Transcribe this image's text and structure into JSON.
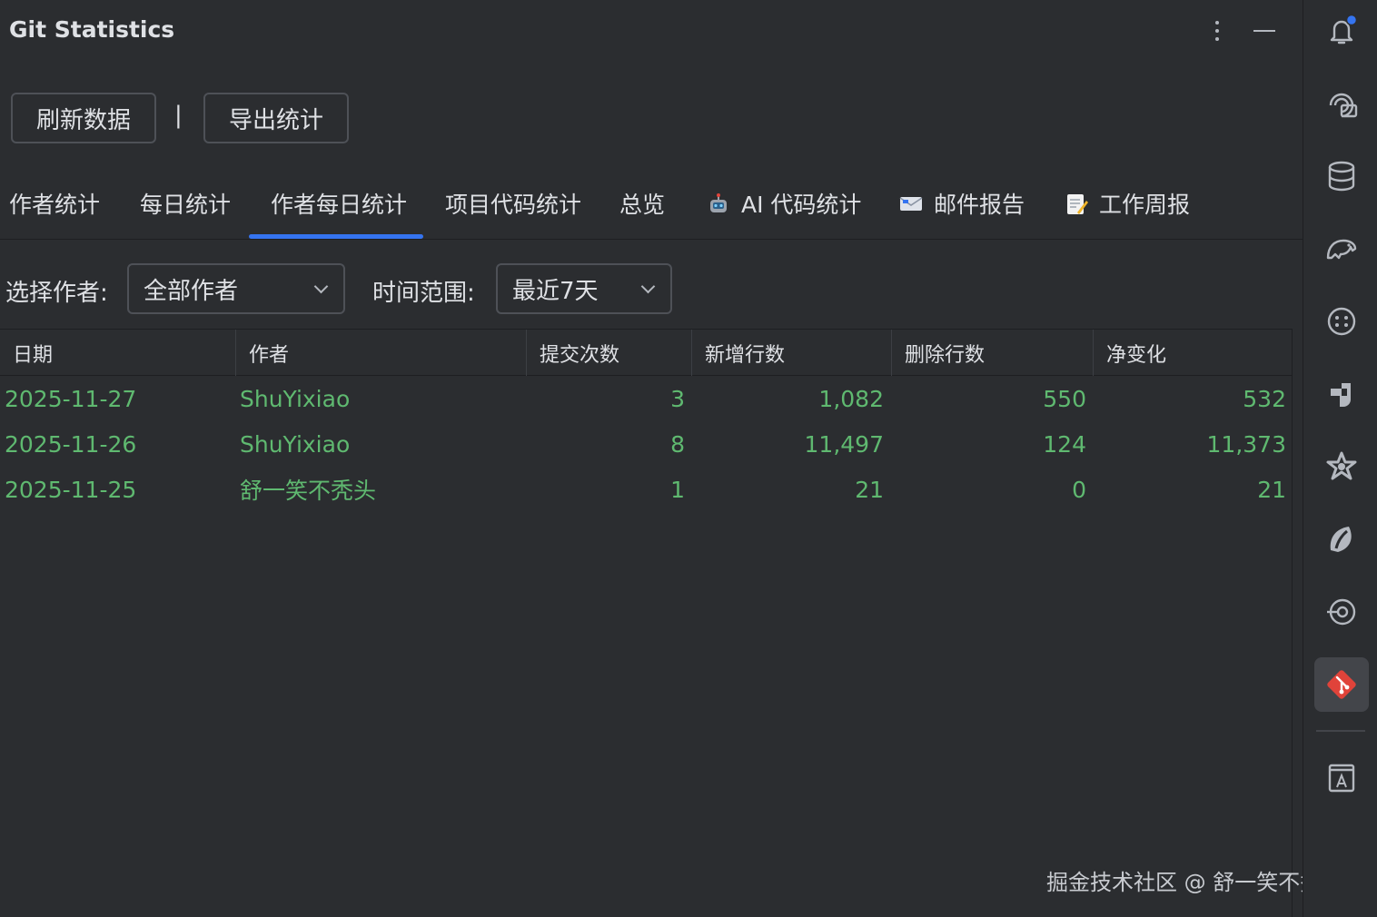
{
  "window": {
    "title": "Git Statistics"
  },
  "toolbar": {
    "refresh_label": "刷新数据",
    "separator": "|",
    "export_label": "导出统计"
  },
  "tabs": [
    {
      "label": "作者统计",
      "icon": ""
    },
    {
      "label": "每日统计",
      "icon": ""
    },
    {
      "label": "作者每日统计",
      "icon": "",
      "active": true
    },
    {
      "label": "项目代码统计",
      "icon": ""
    },
    {
      "label": "总览",
      "icon": ""
    },
    {
      "label": "AI 代码统计",
      "icon": "robot-emoji"
    },
    {
      "label": "邮件报告",
      "icon": "envelope-emoji"
    },
    {
      "label": "工作周报",
      "icon": "memo-emoji"
    }
  ],
  "filters": {
    "author_label": "选择作者:",
    "author_value": "全部作者",
    "range_label": "时间范围:",
    "range_value": "最近7天"
  },
  "table": {
    "columns": [
      "日期",
      "作者",
      "提交次数",
      "新增行数",
      "删除行数",
      "净变化"
    ],
    "rows": [
      [
        "2025-11-27",
        "ShuYixiao",
        "3",
        "1,082",
        "550",
        "532"
      ],
      [
        "2025-11-26",
        "ShuYixiao",
        "8",
        "11,497",
        "124",
        "11,373"
      ],
      [
        "2025-11-25",
        "舒一笑不秃头",
        "1",
        "21",
        "0",
        "21"
      ]
    ]
  },
  "sidebar_tools": [
    {
      "icon": "notifications-bell-icon",
      "badge": true
    },
    {
      "icon": "ai-chat-icon"
    },
    {
      "icon": "database-icon"
    },
    {
      "icon": "elephant-icon"
    },
    {
      "icon": "smiley-plugin-icon"
    },
    {
      "icon": "block-plugin-icon"
    },
    {
      "icon": "star-plugin-icon"
    },
    {
      "icon": "leaf-plugin-icon"
    },
    {
      "icon": "target-plugin-icon"
    },
    {
      "icon": "git-statistics-icon",
      "active": true
    },
    {
      "icon": "font-preview-icon"
    }
  ],
  "colors": {
    "accent": "#3574f0",
    "positive": "#5fb970",
    "git_red": "#e0433a",
    "background": "#2b2d30"
  },
  "watermark": "掘金技术社区 @ 舒一笑不秃头"
}
